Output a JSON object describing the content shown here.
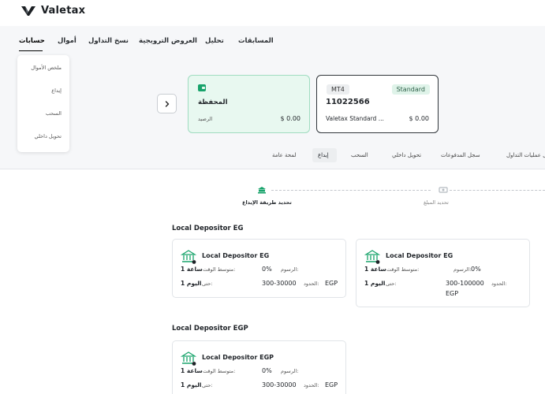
{
  "brand": {
    "name": "Valetax"
  },
  "nav": {
    "items": [
      {
        "label": "حسابات",
        "active": true
      },
      {
        "label": "أموال"
      },
      {
        "label": "نسخ التداول"
      },
      {
        "label": "العروض الترويجية"
      },
      {
        "label": "تحليل"
      },
      {
        "label": "المسابقات"
      }
    ]
  },
  "dropdown": {
    "items": [
      "ملخص الأموال",
      "إيداع",
      "السحب",
      "تحويل داخلي"
    ]
  },
  "wallet_card": {
    "title": "المحفظة",
    "balance_label": "الرصيد",
    "balance": "$ 0.00"
  },
  "account_card": {
    "platform": "MT4",
    "type": "Standard",
    "number": "11022566",
    "name": "Valetax Standard ...",
    "balance": "$ 0.00"
  },
  "tabs": {
    "items": [
      "لمحة عامة",
      "إيداع",
      "السحب",
      "تحويل داخلي",
      "سجل المدفوعات",
      "سجل عمليات التداول"
    ],
    "active_index": 1
  },
  "steps": {
    "items": [
      "تحديد طريقة الإيداع",
      "تحديد المبلغ"
    ],
    "active_index": 0
  },
  "sections": [
    {
      "title": "Local Depositor EG",
      "cards": [
        {
          "name": "Local Depositor EG",
          "fees_label": "الرسوم:",
          "fees": "0%",
          "time_label": "متوسط الوقت:",
          "time": "1 ساعة",
          "limits_label": "الحدود:",
          "limits": "300-30000",
          "currency": "EGP",
          "until_label": "حتى:",
          "until": "1 اليوم"
        },
        {
          "name": "Local Depositor EG",
          "fees_label": "الرسوم:",
          "fees": "0%",
          "time_label": "متوسط الوقت:",
          "time": "1 ساعة",
          "limits_label": "الحدود:",
          "limits": "300-100000",
          "currency": "EGP",
          "until_label": "حتى:",
          "until": "1 اليوم"
        }
      ]
    },
    {
      "title": "Local Depositor EGP",
      "cards": [
        {
          "name": "Local Depositor EGP",
          "fees_label": "الرسوم:",
          "fees": "0%",
          "time_label": "متوسط الوقت:",
          "time": "1 ساعة",
          "limits_label": "الحدود:",
          "limits": "300-30000",
          "currency": "EGP",
          "until_label": "حتى:",
          "until": "1 اليوم"
        }
      ]
    }
  ],
  "colors": {
    "accent_green": "#18a36b",
    "wallet_bg": "#e8f8f0",
    "wallet_border": "#9fdcc0"
  }
}
